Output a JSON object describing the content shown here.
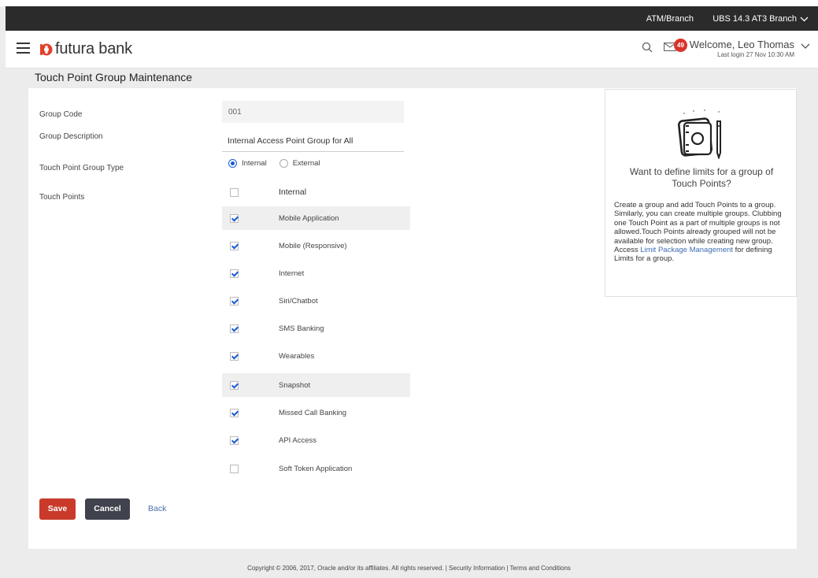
{
  "topbar": {
    "entity_label": "ATM/Branch",
    "branch_label": "UBS 14.3 AT3 Branch"
  },
  "header": {
    "brand": "futura bank",
    "notification_count": "49",
    "welcome": "Welcome, Leo Thomas",
    "last_login": "Last login 27 Nov 10:30 AM"
  },
  "page": {
    "title": "Touch Point Group Maintenance"
  },
  "form": {
    "group_code_label": "Group Code",
    "group_code_value": "001",
    "group_desc_label": "Group Description",
    "group_desc_value": "Internal Access Point Group for All",
    "type_label": "Touch Point Group Type",
    "type_options": [
      {
        "label": "Internal",
        "selected": true
      },
      {
        "label": "External",
        "selected": false
      }
    ],
    "touch_points_label": "Touch Points",
    "touch_points_header": "Internal",
    "touch_points": [
      {
        "name": "Mobile Application",
        "checked": true
      },
      {
        "name": "Mobile (Responsive)",
        "checked": true
      },
      {
        "name": "Internet",
        "checked": true
      },
      {
        "name": "Siri/Chatbot",
        "checked": true
      },
      {
        "name": "SMS Banking",
        "checked": true
      },
      {
        "name": "Wearables",
        "checked": true
      },
      {
        "name": "Snapshot",
        "checked": true
      },
      {
        "name": "Missed Call Banking",
        "checked": true
      },
      {
        "name": "API Access",
        "checked": true
      },
      {
        "name": "Soft Token Application",
        "checked": false
      }
    ]
  },
  "actions": {
    "save": "Save",
    "cancel": "Cancel",
    "back": "Back"
  },
  "help": {
    "title": "Want to define limits for a group of Touch Points?",
    "text_before": "Create a group and add Touch Points to a group. Similarly, you can create multiple groups. Clubbing one Touch Point as a part of multiple groups is not allowed.Touch Points already grouped will not be available for selection while creating new group. Access ",
    "link": "Limit Package Management",
    "text_after": " for defining Limits for a group."
  },
  "footer": {
    "text": "Copyright © 2006, 2017, Oracle and/or its affiliates. All rights reserved. | Security Information | Terms and Conditions"
  },
  "colors": {
    "primary_button": "#c93a2a",
    "secondary_button": "#40434d",
    "accent": "#1a5bd6",
    "topbar": "#2b2b2b",
    "badge": "#d9342b"
  }
}
